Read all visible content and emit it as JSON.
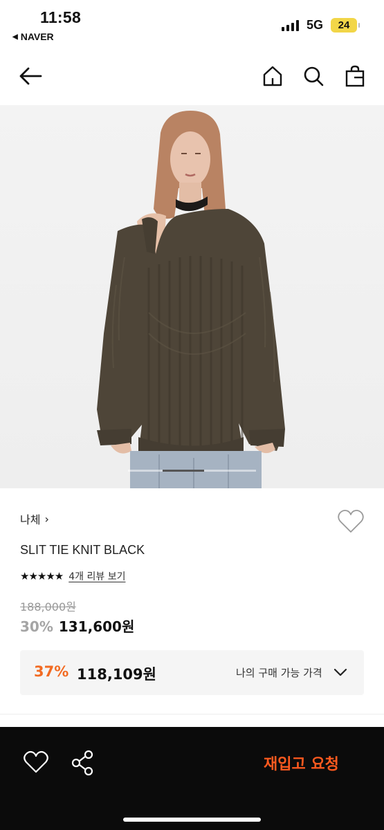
{
  "status_bar": {
    "time": "11:58",
    "back_app": "NAVER",
    "network": "5G",
    "battery": "24"
  },
  "nav": {
    "back": "back-arrow-icon",
    "home": "home-icon",
    "search": "search-icon",
    "bag": "shopping-bag-icon"
  },
  "product": {
    "brand": "나체",
    "brand_chevron": "›",
    "name": "SLIT TIE KNIT BLACK",
    "stars": "★★★★★",
    "review_link": "4개 리뷰 보기",
    "original_price": "188,000원",
    "discount_pct": "30%",
    "sale_price": "131,600원"
  },
  "my_price": {
    "discount_pct": "37%",
    "price": "118,109원",
    "label": "나의 구매 가능 가격"
  },
  "bottom_bar": {
    "restock_label": "재입고 요청"
  },
  "colors": {
    "accent_orange": "#f26b23",
    "restock_orange": "#ff5a1f",
    "bottom_bar_bg": "#0b0b0b",
    "battery_yellow": "#f2d648",
    "sweater_brown": "#4e4538"
  }
}
